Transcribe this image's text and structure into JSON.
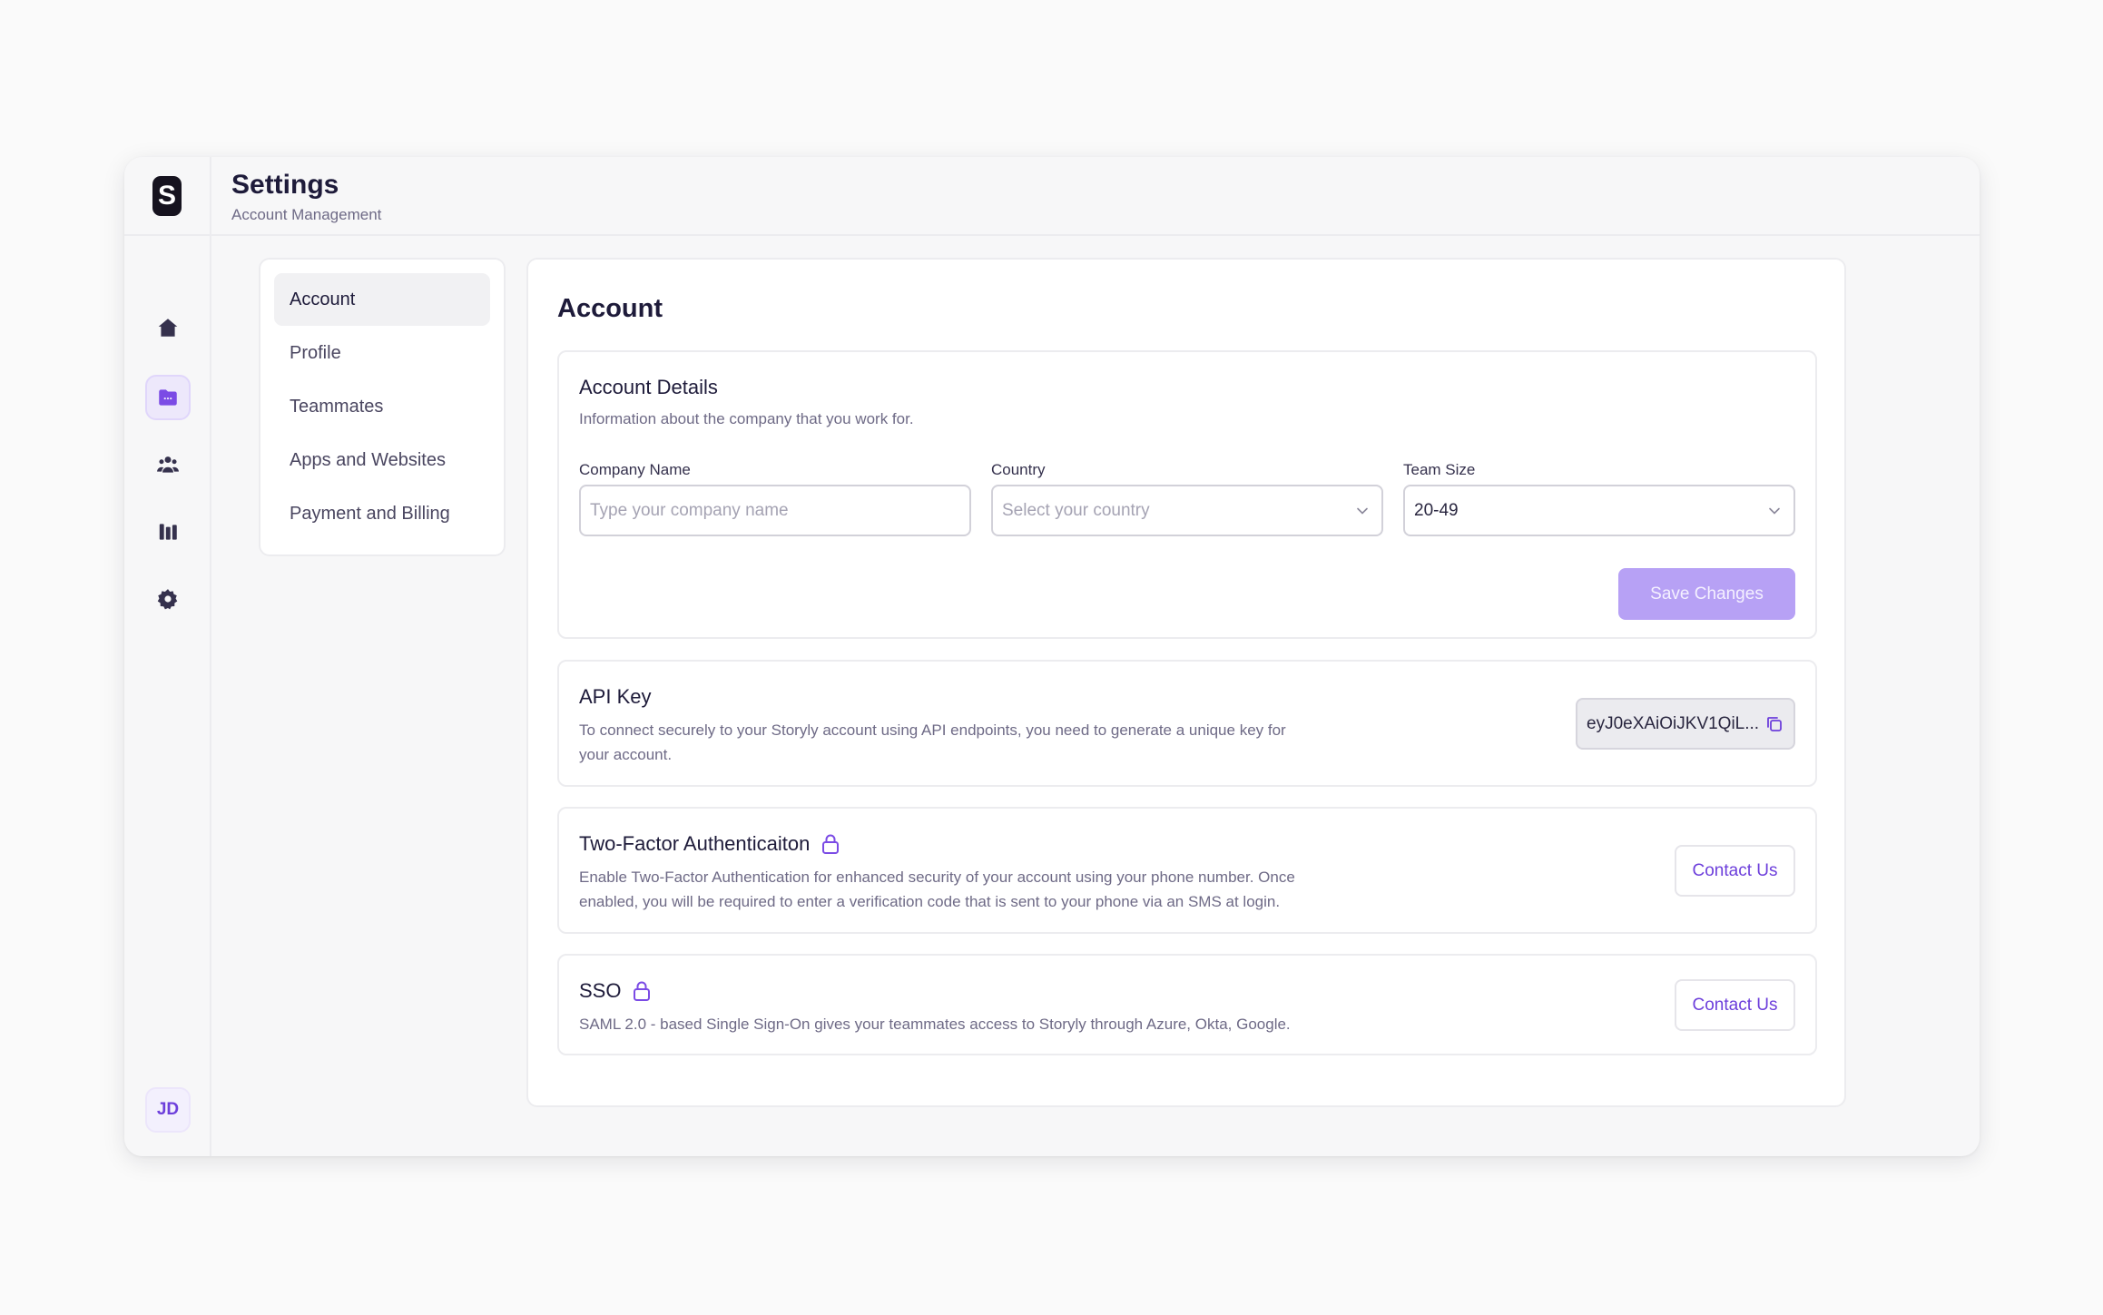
{
  "brand": {
    "logo_letter": "S"
  },
  "rail": {
    "icons": [
      "home-icon",
      "folder-icon",
      "users-icon",
      "analytics-icon",
      "settings-gear-icon"
    ],
    "active": "folder-icon",
    "avatar_initials": "JD"
  },
  "header": {
    "title": "Settings",
    "subtitle": "Account Management"
  },
  "settings_nav": {
    "items": [
      {
        "label": "Account",
        "active": true
      },
      {
        "label": "Profile",
        "active": false
      },
      {
        "label": "Teammates",
        "active": false
      },
      {
        "label": "Apps and Websites",
        "active": false
      },
      {
        "label": "Payment and Billing",
        "active": false
      }
    ]
  },
  "main": {
    "title": "Account",
    "account_details": {
      "title": "Account Details",
      "description": "Information about the company that you work for.",
      "company_name": {
        "label": "Company Name",
        "placeholder": "Type your company name",
        "value": ""
      },
      "country": {
        "label": "Country",
        "placeholder": "Select your country",
        "value": ""
      },
      "team_size": {
        "label": "Team Size",
        "value": "20-49"
      },
      "save_label": "Save Changes"
    },
    "api_key": {
      "title": "API Key",
      "description_line1": "To connect securely to your Storyly account using API endpoints, you need to generate a unique key for",
      "description_line2": "your account.",
      "value": "eyJ0eXAiOiJKV1QiL..."
    },
    "two_factor": {
      "title": "Two-Factor Authenticaiton",
      "description_line1": "Enable Two-Factor Authentication for enhanced security of your account using your phone number. Once",
      "description_line2": "enabled, you will be required to enter a verification code that is sent to your phone via an SMS at login.",
      "button": "Contact Us"
    },
    "sso": {
      "title": "SSO",
      "description": "SAML 2.0 - based Single Sign-On gives your teammates access to Storyly through Azure, Okta, Google.",
      "button": "Contact Us"
    }
  },
  "colors": {
    "accent": "#6d3fdb",
    "accent_disabled": "#b7a1f5",
    "text_primary": "#1e1b3a",
    "text_secondary": "#6e6a86"
  }
}
